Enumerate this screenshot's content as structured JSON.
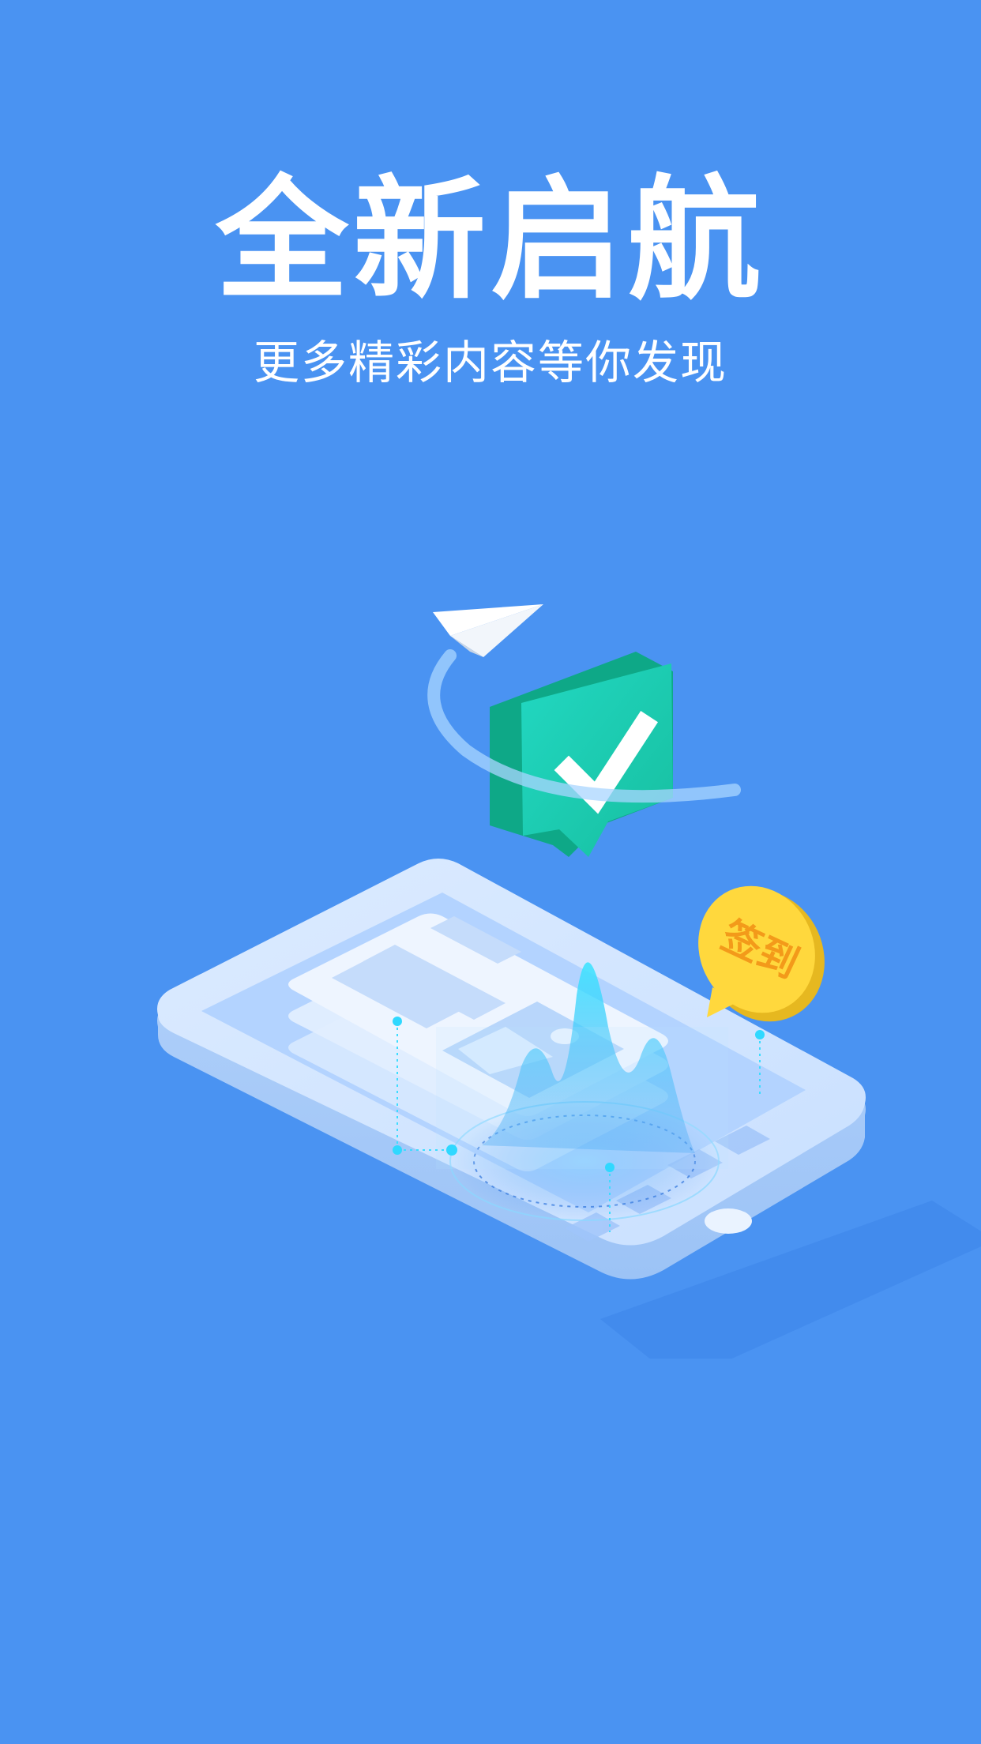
{
  "splash": {
    "title": "全新启航",
    "subtitle": "更多精彩内容等你发现",
    "checkin_label": "签到"
  },
  "colors": {
    "background": "#4A93F2",
    "text": "#FFFFFF",
    "badge_green": "#1BC9A6",
    "checkin_yellow": "#FFD83D",
    "checkin_text": "#F39A1A"
  },
  "icons": [
    "paper-plane-icon",
    "checkmark-shield-icon",
    "checkin-bubble-icon",
    "phone-illustration"
  ]
}
